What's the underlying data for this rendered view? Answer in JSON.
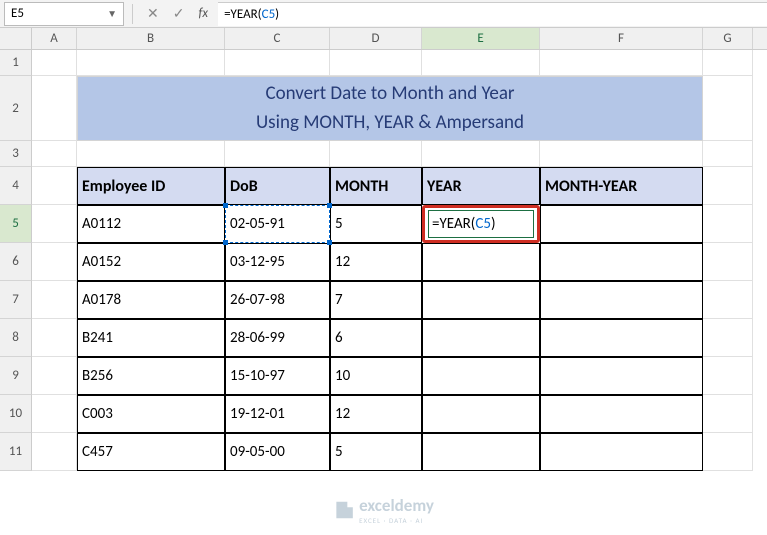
{
  "nameBox": "E5",
  "formula": "=YEAR(C5)",
  "columns": [
    "A",
    "B",
    "C",
    "D",
    "E",
    "F",
    "G"
  ],
  "title": {
    "line1": "Convert Date to Month and Year",
    "line2": "Using MONTH, YEAR & Ampersand"
  },
  "headers": {
    "empId": "Employee ID",
    "dob": "DoB",
    "month": "MONTH",
    "year": "YEAR",
    "monthYear": "MONTH-YEAR"
  },
  "rows": [
    {
      "n": "5",
      "id": "A0112",
      "dob": "02-05-91",
      "month": "5",
      "year": "=YEAR(C5)"
    },
    {
      "n": "6",
      "id": "A0152",
      "dob": "03-12-95",
      "month": "12",
      "year": ""
    },
    {
      "n": "7",
      "id": "A0178",
      "dob": "26-07-98",
      "month": "7",
      "year": ""
    },
    {
      "n": "8",
      "id": "B241",
      "dob": "28-06-99",
      "month": "6",
      "year": ""
    },
    {
      "n": "9",
      "id": "B256",
      "dob": "15-10-97",
      "month": "10",
      "year": ""
    },
    {
      "n": "10",
      "id": "C003",
      "dob": "19-12-01",
      "month": "12",
      "year": ""
    },
    {
      "n": "11",
      "id": "C457",
      "dob": "09-05-00",
      "month": "5",
      "year": ""
    }
  ],
  "watermark": {
    "text": "exceldemy",
    "sub": "EXCEL · DATA · AI"
  },
  "activeCell": {
    "row": 5,
    "col": "E"
  },
  "referencedCell": {
    "row": 5,
    "col": "C"
  },
  "chart_data": {
    "type": "table",
    "title": "Convert Date to Month and Year Using MONTH, YEAR & Ampersand",
    "columns": [
      "Employee ID",
      "DoB",
      "MONTH",
      "YEAR",
      "MONTH-YEAR"
    ],
    "rows": [
      [
        "A0112",
        "02-05-91",
        5,
        "=YEAR(C5)",
        ""
      ],
      [
        "A0152",
        "03-12-95",
        12,
        "",
        ""
      ],
      [
        "A0178",
        "26-07-98",
        7,
        "",
        ""
      ],
      [
        "B241",
        "28-06-99",
        6,
        "",
        ""
      ],
      [
        "B256",
        "15-10-97",
        10,
        "",
        ""
      ],
      [
        "C003",
        "19-12-01",
        12,
        "",
        ""
      ],
      [
        "C457",
        "09-05-00",
        5,
        "",
        ""
      ]
    ]
  }
}
